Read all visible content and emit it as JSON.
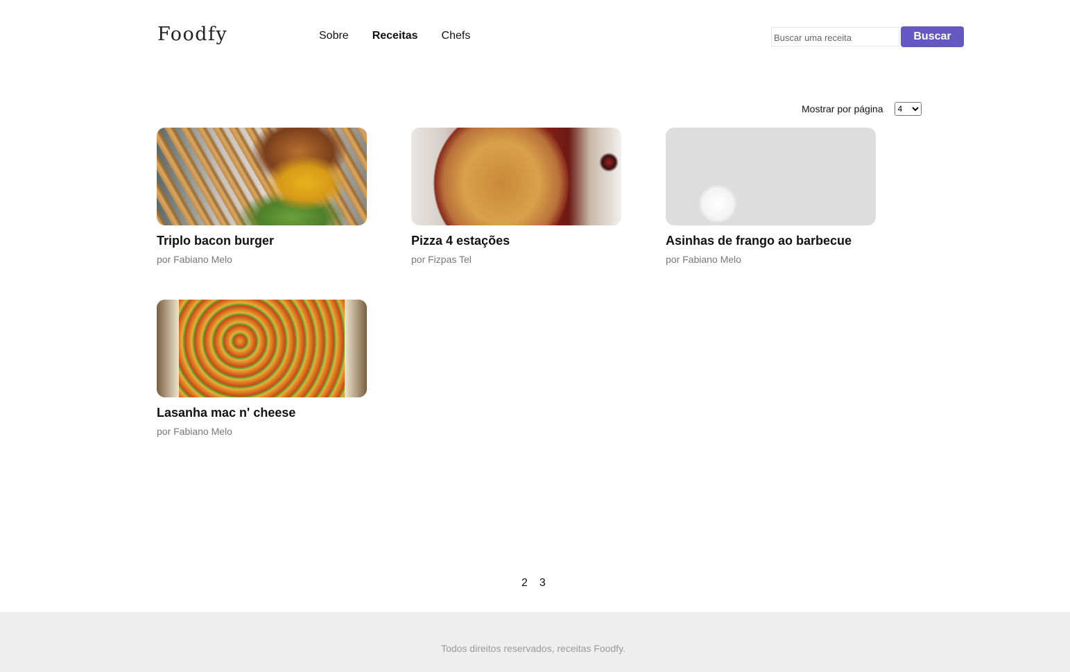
{
  "header": {
    "logo": "Foodfy",
    "nav": [
      {
        "label": "Sobre",
        "active": false
      },
      {
        "label": "Receitas",
        "active": true
      },
      {
        "label": "Chefs",
        "active": false
      }
    ],
    "search": {
      "placeholder": "Buscar uma receita",
      "value": "",
      "button_label": "Buscar",
      "button_color": "#6558c3"
    }
  },
  "controls": {
    "per_page_label": "Mostrar por página",
    "per_page_value": "4"
  },
  "recipes": [
    {
      "title": "Triplo bacon burger",
      "author": "por Fabiano Melo",
      "image": "burger-photo"
    },
    {
      "title": "Pizza 4 estações",
      "author": "por Fizpas Tel",
      "image": "pizza-photo"
    },
    {
      "title": "Asinhas de frango ao barbecue",
      "author": "por Fabiano Melo",
      "image": "chicken-wings-photo"
    },
    {
      "title": "Lasanha mac n' cheese",
      "author": "por Fabiano Melo",
      "image": "lasagna-photo"
    }
  ],
  "pagination": {
    "pages": [
      "2",
      "3"
    ]
  },
  "footer": {
    "text": "Todos direitos reservados, receitas Foodfy."
  }
}
